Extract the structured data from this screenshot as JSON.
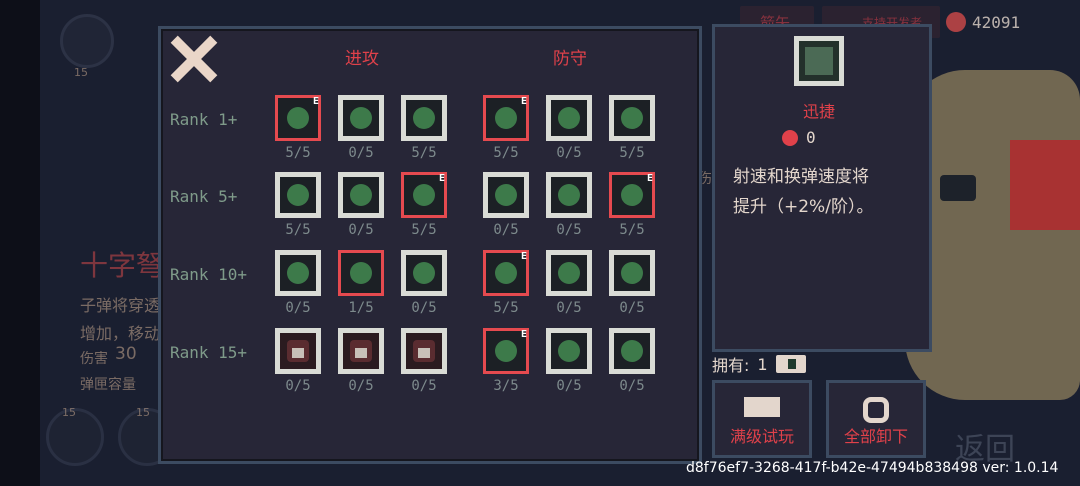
{
  "top_bar": {
    "chip1_label": "箭矢",
    "chip2_label": "支持开发者",
    "currency_amount": "42091"
  },
  "background": {
    "weapon_name": "十字弩",
    "weapon_desc_line1": "子弹将穿透",
    "weapon_desc_line2": "增加，移动",
    "damage_label": "伤害",
    "damage_value": "30",
    "ammo_label": "弹匣容量",
    "side_label": "伤",
    "skill_levels": [
      "15",
      "15"
    ],
    "back_label": "返回"
  },
  "panel": {
    "attack_title": "进攻",
    "defense_title": "防守",
    "rows": [
      {
        "rank": "Rank 1+",
        "tiles": [
          {
            "icon": "dash-stripes-icon",
            "count": "5/5",
            "active": true,
            "e": true
          },
          {
            "icon": "swirl-icon",
            "count": "0/5",
            "active": false,
            "e": false
          },
          {
            "icon": "fist-icon",
            "count": "5/5",
            "active": false,
            "e": false
          },
          {
            "icon": "octagon-shield-icon",
            "count": "5/5",
            "active": true,
            "e": true
          },
          {
            "icon": "snake-icon",
            "count": "0/5",
            "active": false,
            "e": false
          },
          {
            "icon": "shield-clock-icon",
            "count": "5/5",
            "active": false,
            "e": false
          }
        ]
      },
      {
        "rank": "Rank 5+",
        "tiles": [
          {
            "icon": "spread-arrows-icon",
            "count": "5/5",
            "active": false,
            "e": false
          },
          {
            "icon": "claw-icon",
            "count": "0/5",
            "active": false,
            "e": false
          },
          {
            "icon": "wave-icon",
            "count": "5/5",
            "active": true,
            "e": true
          },
          {
            "icon": "cycle-icon",
            "count": "0/5",
            "active": false,
            "e": false
          },
          {
            "icon": "chevron-icon",
            "count": "0/5",
            "active": false,
            "e": false
          },
          {
            "icon": "leaf-drop-icon",
            "count": "5/5",
            "active": true,
            "e": true
          }
        ]
      },
      {
        "rank": "Rank 10+",
        "tiles": [
          {
            "icon": "potion-icon",
            "count": "0/5",
            "active": false,
            "e": false
          },
          {
            "icon": "rune-icon",
            "count": "1/5",
            "active": true,
            "e": false
          },
          {
            "icon": "sparkle-orb-icon",
            "count": "0/5",
            "active": false,
            "e": false
          },
          {
            "icon": "down-arrow-orb-icon",
            "count": "5/5",
            "active": true,
            "e": true
          },
          {
            "icon": "hearts-icon",
            "count": "0/5",
            "active": false,
            "e": false
          },
          {
            "icon": "reaper-icon",
            "count": "0/5",
            "active": false,
            "e": false
          }
        ]
      },
      {
        "rank": "Rank 15+",
        "tiles": [
          {
            "icon": "lock-icon",
            "count": "0/5",
            "active": false,
            "e": false,
            "locked": true
          },
          {
            "icon": "lock-icon",
            "count": "0/5",
            "active": false,
            "e": false,
            "locked": true
          },
          {
            "icon": "lock-icon",
            "count": "0/5",
            "active": false,
            "e": false,
            "locked": true
          },
          {
            "icon": "holy-heart-icon",
            "count": "3/5",
            "active": true,
            "e": true
          },
          {
            "icon": "angel-icon",
            "count": "0/5",
            "active": false,
            "e": false
          },
          {
            "icon": "medic-demon-icon",
            "count": "0/5",
            "active": false,
            "e": false
          }
        ]
      }
    ]
  },
  "info": {
    "name": "迅捷",
    "cost": "0",
    "desc_line1": "射速和换弹速度将",
    "desc_line2": "提升（+2%/阶）。",
    "owned_label": "拥有:",
    "owned_value": "1",
    "trial_button": "满级试玩",
    "unequip_button": "全部卸下"
  },
  "footer": {
    "version": "d8f76ef7-3268-417f-b42e-47494b838498 ver: 1.0.14"
  },
  "colors": {
    "accent_red": "#e54a4f",
    "panel_bg": "#272637",
    "panel_border": "#3c4b61",
    "tile_light": "#d9dbd5"
  }
}
